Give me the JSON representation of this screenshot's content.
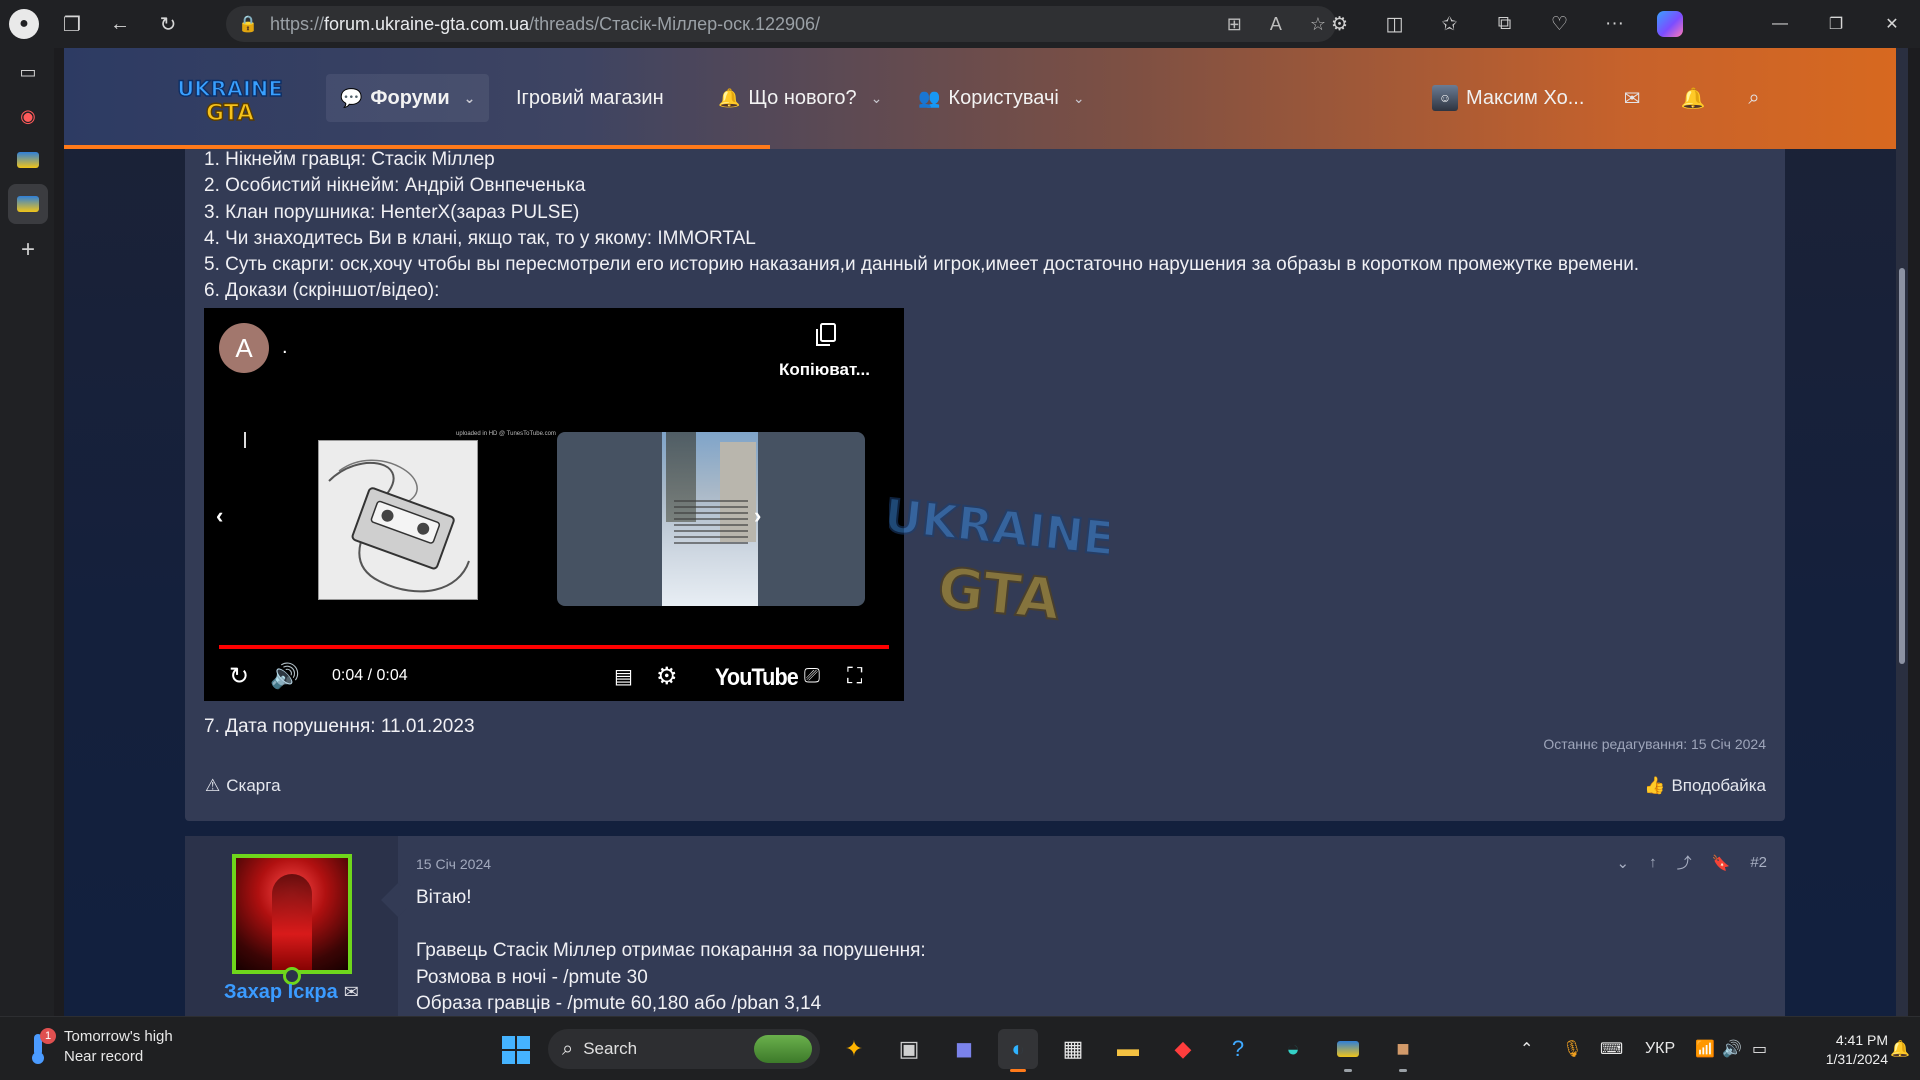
{
  "browser": {
    "url_prefix": "https://",
    "url_host": "forum.ukraine-gta.com.ua",
    "url_path": "/threads/Стасік-Міллер-оск.122906/"
  },
  "nav": {
    "logo_line1": "UKRAINE",
    "logo_line2": "GTA",
    "forums": "Форуми",
    "shop": "Ігровий магазин",
    "whats_new": "Що нового?",
    "users": "Користувачі",
    "username": "Максим Хо..."
  },
  "post1": {
    "lines": [
      "1. Нікнейм гравця: Стасік Міллер",
      "2. Особистий нікнейм: Андрій Овнпеченька",
      "3. Клан порушника: HenterX(зараз PULSE)",
      "4. Чи знаходитесь Ви в клані, якщо так, то у якому: IMMORTAL",
      "5. Суть скарги: оск,хочу чтобы вы пересмотрели его историю наказания,и данный игрок,имеет достаточно нарушения за образы в коротком промежутке времени.",
      "6. Докази (скріншот/відео):"
    ],
    "date_line": "7. Дата порушення: 11.01.2023",
    "edited": "Останнє редагування: 15 Січ 2024",
    "report": "Скарга",
    "like": "Вподобайка",
    "video": {
      "avatar_letter": "A",
      "title": ".",
      "copy_label": "Копіюват...",
      "time": "0:04 / 0:04",
      "brand": "YouTube",
      "thumb_caption": "uploaded in HD @ TunesToTube.com",
      "progress": 1.0
    }
  },
  "post2": {
    "author": "Захар Іскра",
    "date": "15 Січ 2024",
    "number": "#2",
    "greeting": "Вітаю!",
    "body": [
      "Гравець Стасік Міллер отримає покарання за порушення:",
      "Розмова в ночі - /pmute 30",
      "Образа гравців - /pmute 60,180 або /pban 3,14"
    ]
  },
  "taskbar": {
    "weather_title": "Tomorrow's high",
    "weather_sub": "Near record",
    "weather_badge": "1",
    "search": "Search",
    "lang": "УКР",
    "time": "4:41 PM",
    "date": "1/31/2024"
  },
  "colors": {
    "accent_orange": "#ff7a1a",
    "post_bg": "#333b55",
    "username_blue": "#3b9bff",
    "online_green": "#6fd61c"
  }
}
